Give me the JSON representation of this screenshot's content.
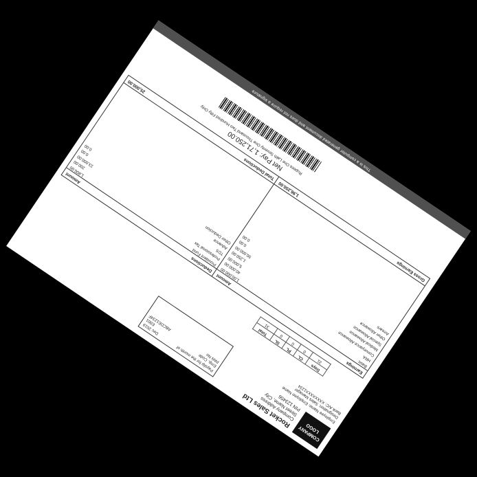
{
  "company": {
    "logo_line1": "COMPANY",
    "logo_line2": "LOGO",
    "name": "Rocket Sales Ltd",
    "address1": "Company Address",
    "address2": "Street Name, City",
    "address3": "PIN 123456"
  },
  "payslip": {
    "title_label": "Payslip for the month of",
    "month": "Dec 2019",
    "emp_code_label": "Emp. Code",
    "emp_code": "E001",
    "pan_label": "PAN No",
    "pan": "ABCDE1234F"
  },
  "employee": {
    "name_label": "Employee Name",
    "name": "Employee Name",
    "designation_label": "Designation",
    "designation": "Sales Manager",
    "bank_label": "Bank A/C",
    "bank": "XXXXXXXX1234"
  },
  "attendance": {
    "headers": [
      "Days",
      "CL",
      "PL",
      "SL",
      "Total"
    ],
    "values": [
      "31",
      "0",
      "0",
      "0",
      "31"
    ]
  },
  "earnings": {
    "title": "Earnings",
    "amount_label": "Amount",
    "items": [
      {
        "label": "Basic",
        "value": "1,00,000.00"
      },
      {
        "label": "HRA",
        "value": "40,000.00"
      },
      {
        "label": "Conveyance Allowance",
        "value": "5,000.00"
      },
      {
        "label": "Medical Allowance",
        "value": "1,250.00"
      },
      {
        "label": "Special Allowance",
        "value": "50,000.00"
      },
      {
        "label": "Other Allowance",
        "value": "0.00"
      },
      {
        "label": "Arrears",
        "value": "0.00"
      }
    ],
    "total_label": "Gross Earnings",
    "total": "1,96,250.00"
  },
  "deductions": {
    "title": "Deductions",
    "amount_label": "Amount",
    "items": [
      {
        "label": "Provident Fund",
        "value": "1,800.00"
      },
      {
        "label": "Professional Tax",
        "value": "200.00"
      },
      {
        "label": "TDS",
        "value": "23,000.00"
      },
      {
        "label": "Advance",
        "value": "0.00"
      },
      {
        "label": "Other Deduction",
        "value": "0.00"
      }
    ],
    "total_label": "Total Deductions",
    "total": "25,000.00"
  },
  "netpay": {
    "label": "Net Pay",
    "amount": "1,71,250.00",
    "words": "Rupees One Lakh Seventy One Thousand Two Hundred Fifty Only"
  },
  "banner": "This is a computer generated document and does not require a signature"
}
